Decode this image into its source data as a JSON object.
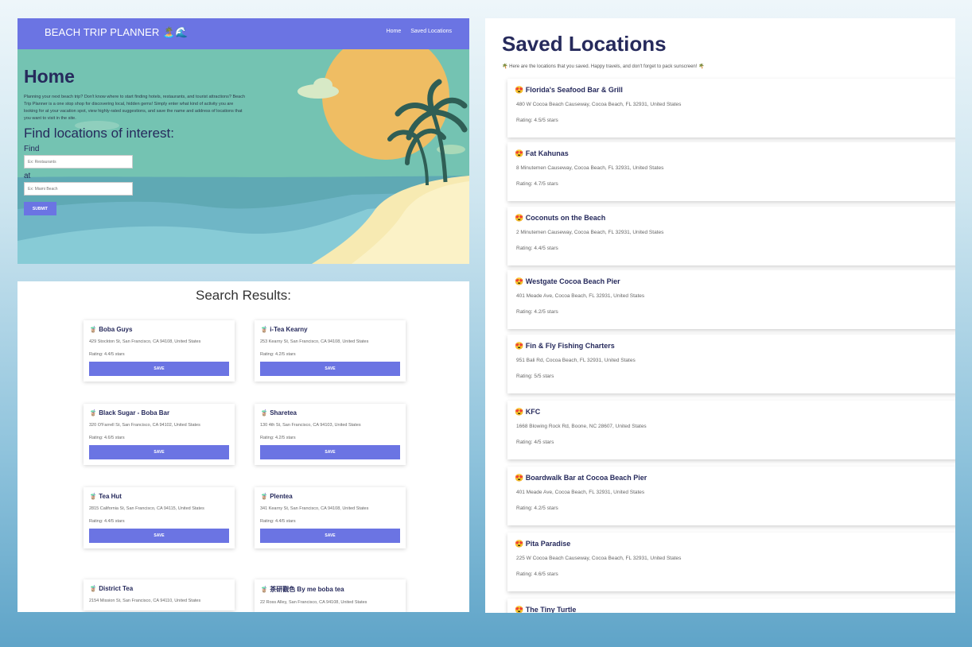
{
  "home": {
    "nav_title": "BEACH TRIP PLANNER 🏝️🌊",
    "nav_links": [
      "Home",
      "Saved Locations"
    ],
    "title": "Home",
    "description": "Planning your next beach trip? Don't know where to start finding hotels, restaurants, and tourist attractions? Beach Trip Planner is a one stop shop for discovering local, hidden gems! Simply enter what kind of activity you are looking for at your vacation spot, view highly-rated suggestions, and save the name and address of locations that you want to visit in the site.",
    "find_title": "Find locations of interest:",
    "find_label": "Find",
    "find_placeholder": "Ex: Restaurants",
    "at_label": "at",
    "at_placeholder": "Ex: Miami Beach",
    "submit_label": "SUBMIT"
  },
  "results": {
    "title": "Search Results:",
    "save_label": "SAVE",
    "icon": "🧋",
    "items": [
      {
        "name": "Boba Guys",
        "address": "429 Stockton St, San Francisco, CA 94108, United States",
        "rating": "Rating: 4.4/5 stars"
      },
      {
        "name": "i-Tea Kearny",
        "address": "253 Kearny St, San Francisco, CA 94108, United States",
        "rating": "Rating: 4.2/5 stars"
      },
      {
        "name": "Black Sugar - Boba Bar",
        "address": "320 O'Farrell St, San Francisco, CA 94102, United States",
        "rating": "Rating: 4.6/5 stars"
      },
      {
        "name": "Sharetea",
        "address": "130 4th St, San Francisco, CA 94103, United States",
        "rating": "Rating: 4.2/5 stars"
      },
      {
        "name": "Tea Hut",
        "address": "2815 California St, San Francisco, CA 94115, United States",
        "rating": "Rating: 4.4/5 stars"
      },
      {
        "name": "Plentea",
        "address": "341 Kearny St, San Francisco, CA 94108, United States",
        "rating": "Rating: 4.4/5 stars"
      },
      {
        "name": "District Tea",
        "address": "2154 Mission St, San Francisco, CA 94110, United States",
        "rating": ""
      },
      {
        "name": "茶研觀色 By me boba tea",
        "address": "22 Ross Alley, San Francisco, CA 94108, United States",
        "rating": ""
      }
    ]
  },
  "saved": {
    "title": "Saved Locations",
    "subtitle": "🌴 Here are the locations that you saved. Happy travels, and don't forget to pack sunscreen! 🌴",
    "icon": "😍",
    "items": [
      {
        "name": "Florida's Seafood Bar & Grill",
        "address": "480 W Cocoa Beach Causeway, Cocoa Beach, FL 32931, United States",
        "rating": "Rating: 4.5/5 stars"
      },
      {
        "name": "Fat Kahunas",
        "address": "8 Minutemen Causeway, Cocoa Beach, FL 32931, United States",
        "rating": "Rating: 4.7/5 stars"
      },
      {
        "name": "Coconuts on the Beach",
        "address": "2 Minutemen Causeway, Cocoa Beach, FL 32931, United States",
        "rating": "Rating: 4.4/5 stars"
      },
      {
        "name": "Westgate Cocoa Beach Pier",
        "address": "401 Meade Ave, Cocoa Beach, FL 32931, United States",
        "rating": "Rating: 4.2/5 stars"
      },
      {
        "name": "Fin & Fly Fishing Charters",
        "address": "951 Bali Rd, Cocoa Beach, FL 32931, United States",
        "rating": "Rating: 5/5 stars"
      },
      {
        "name": "KFC",
        "address": "1668 Blowing Rock Rd, Boone, NC 28607, United States",
        "rating": "Rating: 4/5 stars"
      },
      {
        "name": "Boardwalk Bar at Cocoa Beach Pier",
        "address": "401 Meade Ave, Cocoa Beach, FL 32931, United States",
        "rating": "Rating: 4.2/5 stars"
      },
      {
        "name": "Pita Paradise",
        "address": "225 W Cocoa Beach Causeway, Cocoa Beach, FL 32931, United States",
        "rating": "Rating: 4.6/5 stars"
      },
      {
        "name": "The Tiny Turtle",
        "address": "",
        "rating": ""
      }
    ]
  }
}
